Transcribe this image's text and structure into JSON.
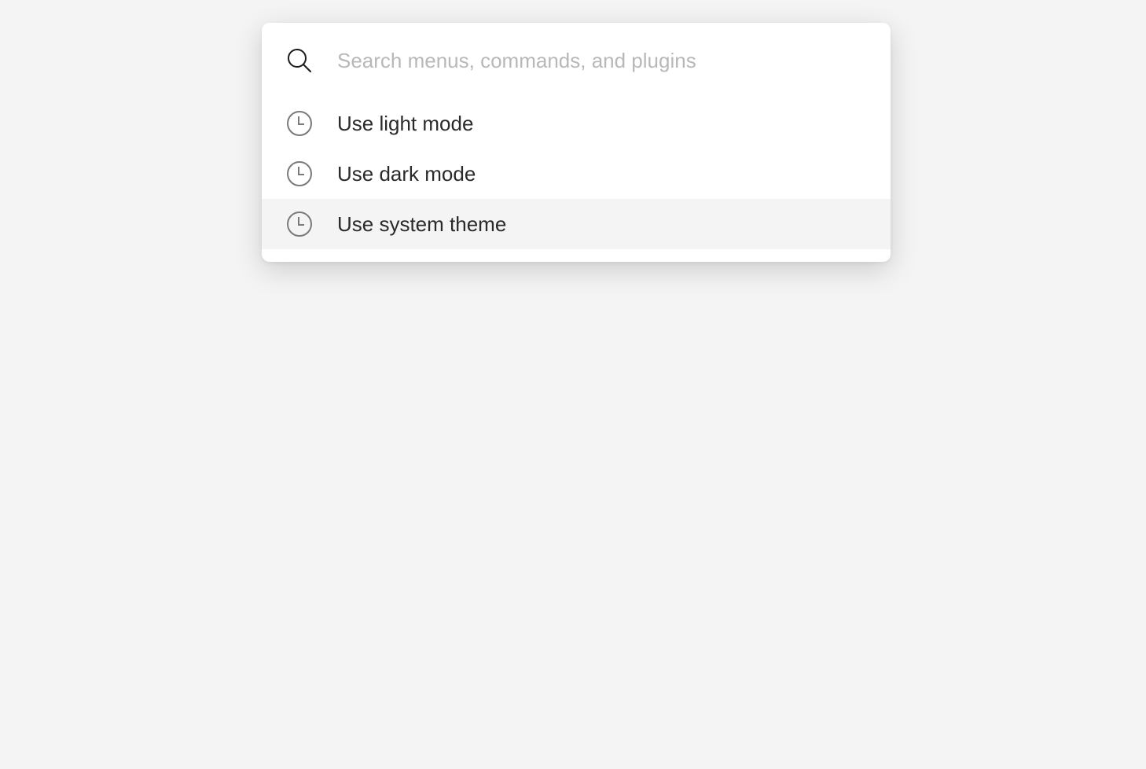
{
  "search": {
    "placeholder": "Search menus, commands, and plugins",
    "value": "",
    "icon": "search-icon"
  },
  "items": [
    {
      "label": "Use light mode",
      "icon": "clock-icon",
      "active": false
    },
    {
      "label": "Use dark mode",
      "icon": "clock-icon",
      "active": false
    },
    {
      "label": "Use system theme",
      "icon": "clock-icon",
      "active": true
    }
  ],
  "colors": {
    "background": "#f4f4f4",
    "panel": "#ffffff",
    "text": "#2a2a2a",
    "placeholder": "#b8b8b8",
    "icon": "#7a7a7a",
    "hover": "#f4f4f4"
  }
}
